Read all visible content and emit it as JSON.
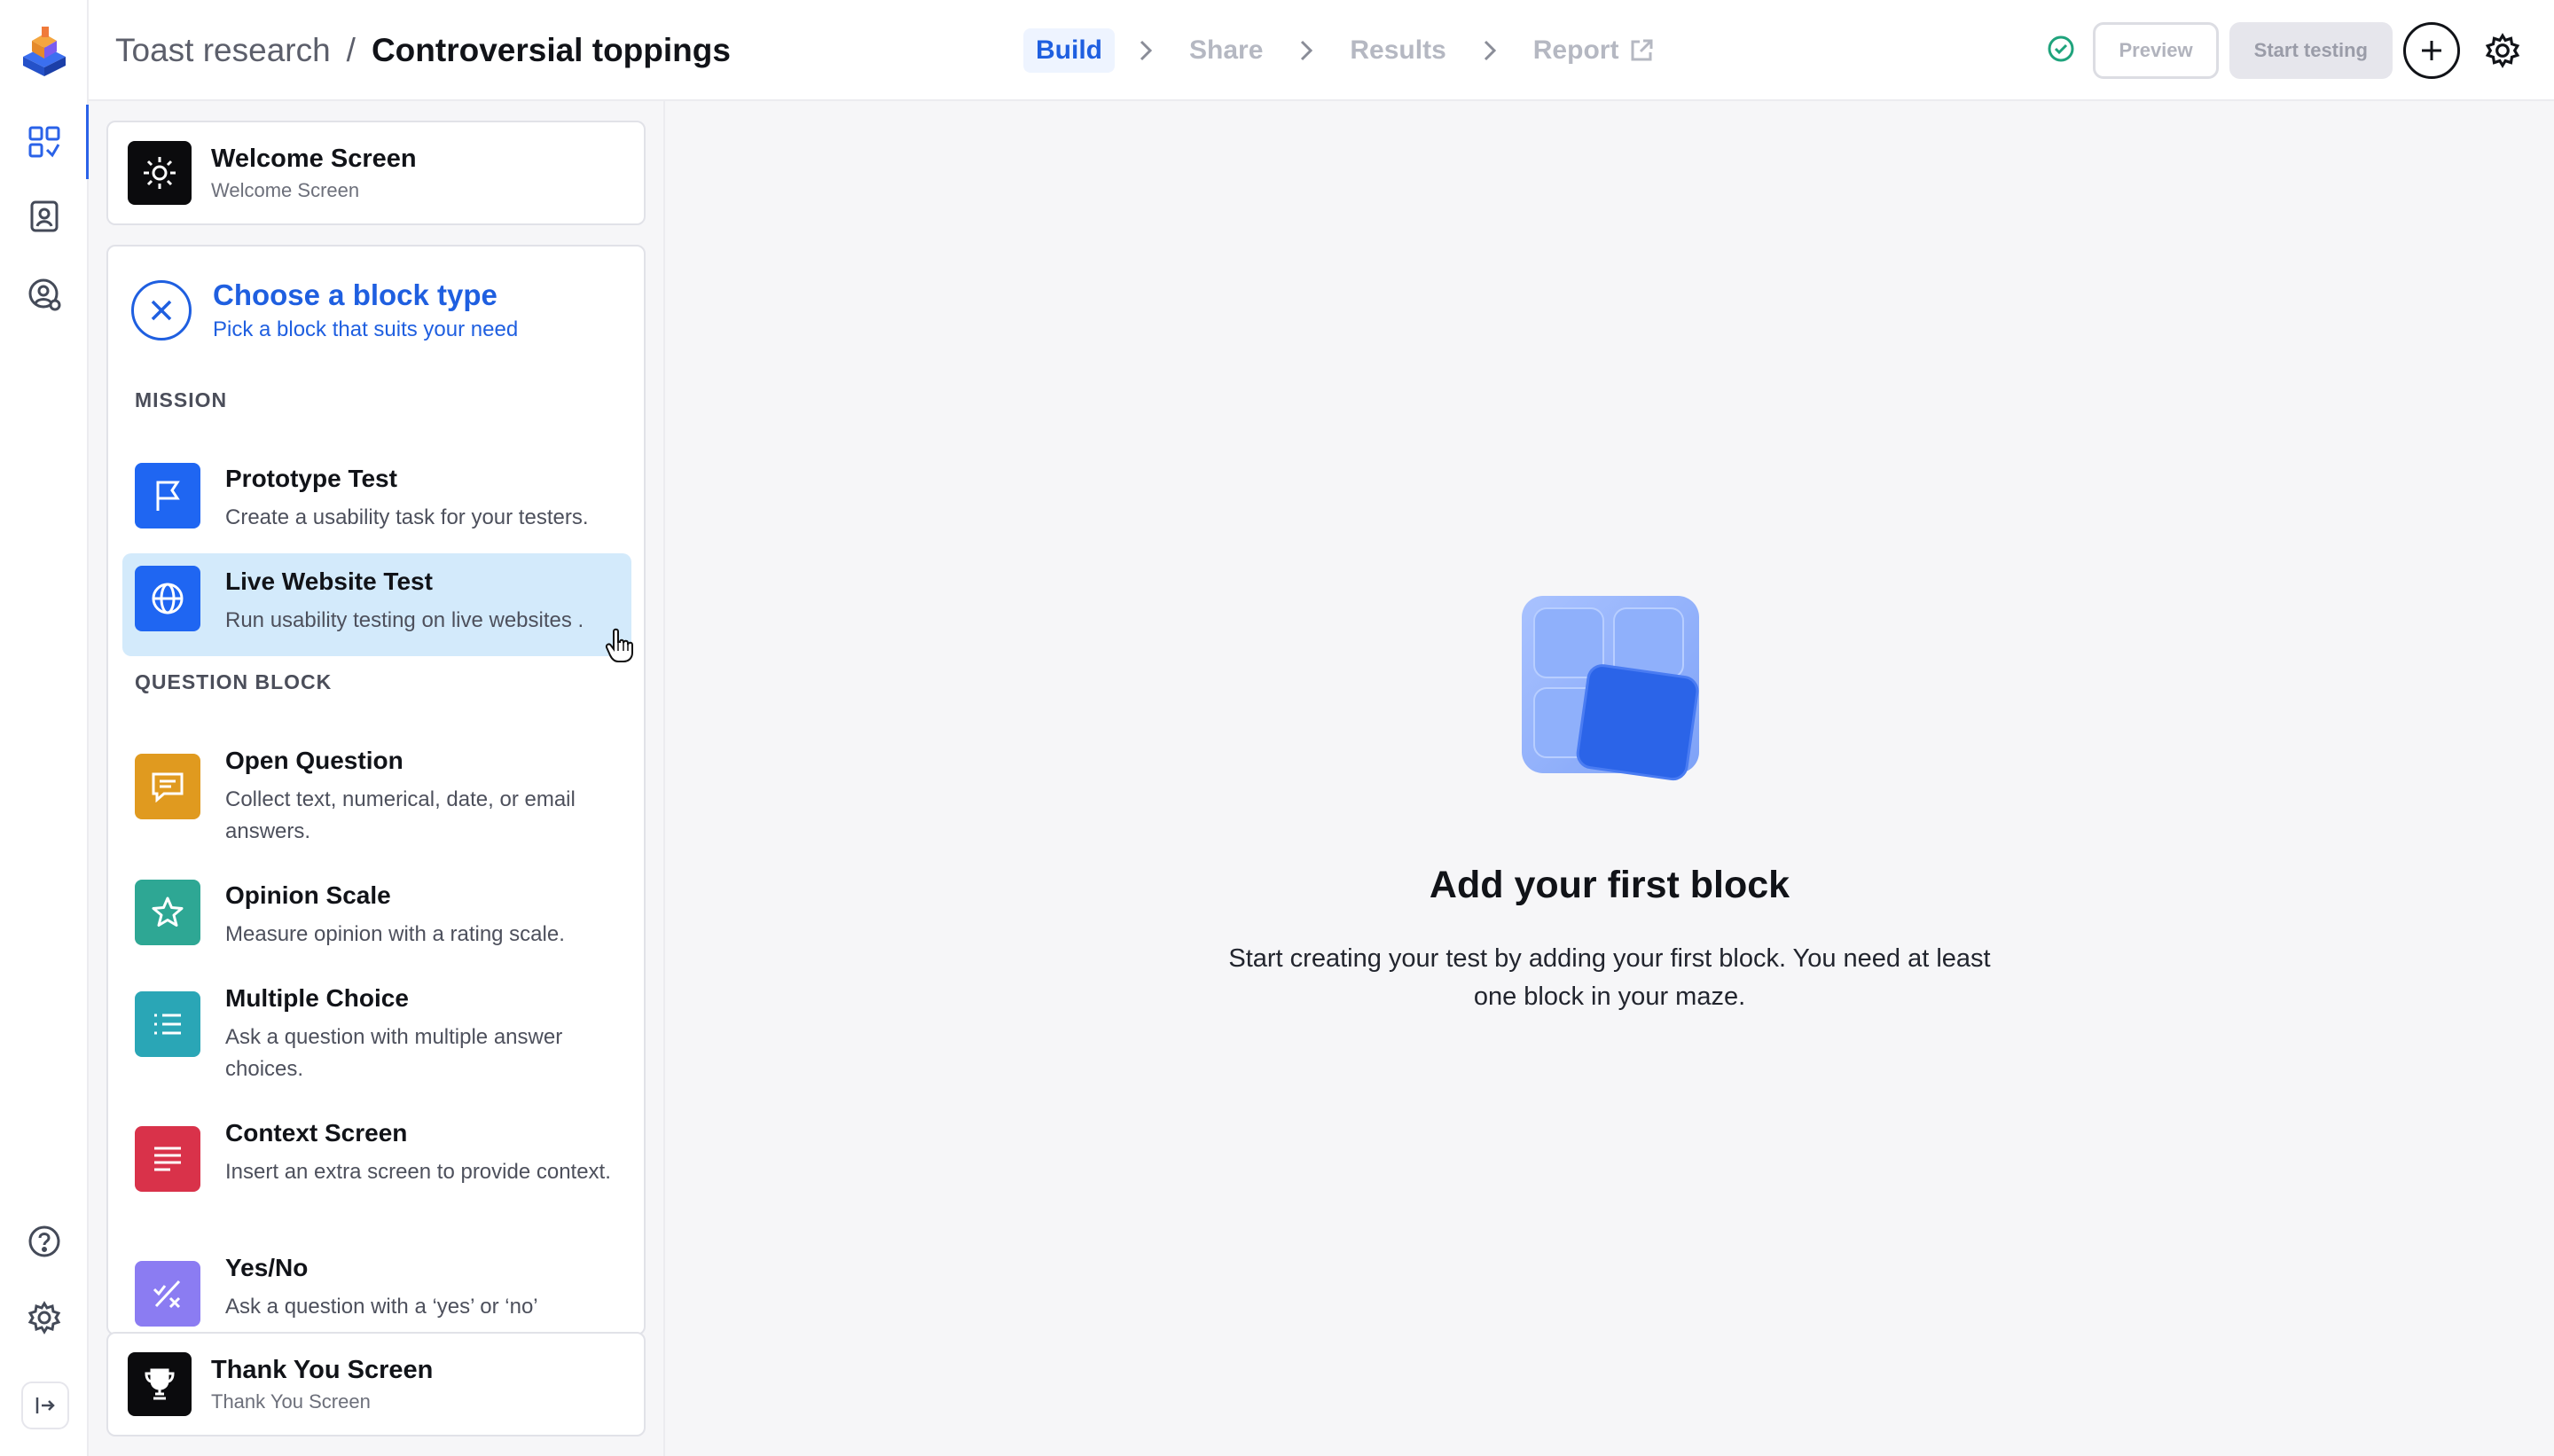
{
  "breadcrumb": {
    "project": "Toast research",
    "separator": "/",
    "title": "Controversial toppings"
  },
  "steps": [
    {
      "label": "Build",
      "active": true
    },
    {
      "label": "Share",
      "active": false
    },
    {
      "label": "Results",
      "active": false
    },
    {
      "label": "Report",
      "active": false
    }
  ],
  "actions": {
    "preview_label": "Preview",
    "start_label": "Start testing"
  },
  "welcome_screen": {
    "title": "Welcome Screen",
    "subtitle": "Welcome Screen"
  },
  "chooser": {
    "title": "Choose a block type",
    "subtitle": "Pick a block that suits your need",
    "sections": [
      {
        "label": "MISSION",
        "items": [
          {
            "title": "Prototype Test",
            "desc": "Create a usability task for your testers.",
            "color": "#1f66f2",
            "icon": "flag-icon"
          },
          {
            "title": "Live Website Test",
            "desc": "Run usability testing on live websites .",
            "color": "#1f66f2",
            "icon": "globe-icon",
            "hover": true
          }
        ]
      },
      {
        "label": "QUESTION BLOCK",
        "items": [
          {
            "title": "Open Question",
            "desc": "Collect text, numerical, date, or email answers.",
            "color": "#e09a1f",
            "icon": "message-icon"
          },
          {
            "title": "Opinion Scale",
            "desc": "Measure opinion with a rating scale.",
            "color": "#2ea794",
            "icon": "star-icon"
          },
          {
            "title": "Multiple Choice",
            "desc": "Ask a question with multiple answer choices.",
            "color": "#2aa6b6",
            "icon": "list-icon"
          },
          {
            "title": "Context Screen",
            "desc": "Insert an extra screen to provide context.",
            "color": "#d9324a",
            "icon": "text-lines-icon"
          },
          {
            "title": "Yes/No",
            "desc": "Ask a question with a ‘yes’ or ‘no’",
            "color": "#8b7cf2",
            "icon": "yes-no-icon"
          }
        ]
      }
    ]
  },
  "thankyou_screen": {
    "title": "Thank You Screen",
    "subtitle": "Thank You Screen"
  },
  "empty_state": {
    "title": "Add your first block",
    "description": "Start creating your test by adding your first block. You need at least one block in your maze."
  },
  "colors": {
    "accent": "#1f5fe0",
    "hover": "#d3eafb",
    "status_ok": "#1fa37c"
  }
}
